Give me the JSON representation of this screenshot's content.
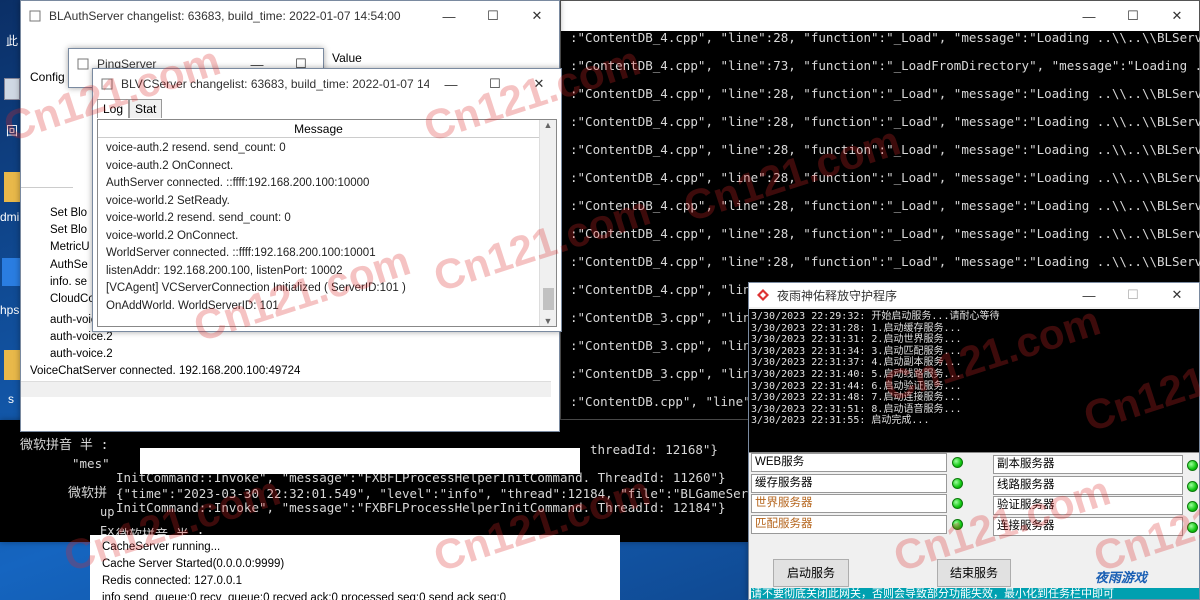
{
  "auth_window": {
    "title": "BLAuthServer changelist: 63683, build_time: 2022-01-07 14:54:00"
  },
  "auth_left_labels": [
    "Config",
    "Set Blo",
    "Set Blo",
    "MetricU",
    "AuthSe",
    "info. se",
    "CloudConn",
    "auth-voice.2",
    "auth-voice.2",
    "auth-voice.2"
  ],
  "auth_bottom_line": "VoiceChatServer connected. 192.168.200.100:49724",
  "ping_window": {
    "title": "PingServer",
    "value_header": "Value"
  },
  "vc_window": {
    "title": "BLVCServer changelist: 63683, build_time: 2022-01-07 14:...",
    "tab_log": "Log",
    "tab_stat": "Stat",
    "col_header": "Message",
    "lines": [
      "voice-auth.2 resend. send_count: 0",
      "voice-auth.2 OnConnect.",
      "AuthServer connected. ::ffff:192.168.200.100:10000",
      "voice-world.2 SetReady.",
      "voice-world.2 resend. send_count: 0",
      "voice-world.2 OnConnect.",
      "WorldServer connected. ::ffff:192.168.200.100:10001",
      "listenAddr: 192.168.200.100, listenPort: 10002",
      "[VCAgent] VCServerConnection Initialized ( ServerID:101 )",
      "OnAddWorld. WorldServerID: 101"
    ]
  },
  "console": {
    "lines": [
      ":\"ContentDB_4.cpp\", \"line\":28, \"function\":\"_Load\", \"message\":\"Loading ..\\\\..\\\\BLServer",
      ":\"ContentDB_4.cpp\", \"line\":73, \"function\":\"_LoadFromDirectory\", \"message\":\"Loading ..",
      ":\"ContentDB_4.cpp\", \"line\":28, \"function\":\"_Load\", \"message\":\"Loading ..\\\\..\\\\BLServer",
      ":\"ContentDB_4.cpp\", \"line\":28, \"function\":\"_Load\", \"message\":\"Loading ..\\\\..\\\\BLServer",
      ":\"ContentDB_4.cpp\", \"line\":28, \"function\":\"_Load\", \"message\":\"Loading ..\\\\..\\\\BLServer",
      ":\"ContentDB_4.cpp\", \"line\":28, \"function\":\"_Load\", \"message\":\"Loading ..\\\\..\\\\BLServer",
      ":\"ContentDB_4.cpp\", \"line\":28, \"function\":\"_Load\", \"message\":\"Loading ..\\\\..\\\\BLServer",
      ":\"ContentDB_4.cpp\", \"line\":28, \"function\":\"_Load\", \"message\":\"Loading ..\\\\..\\\\BLServer",
      ":\"ContentDB_4.cpp\", \"line\":28, \"function\":\"_Load\", \"message\":\"Loading ..\\\\..\\\\BLServer",
      ":\"ContentDB_4.cpp\", \"line\"",
      ":\"ContentDB_3.cpp\", \"line\"",
      ":\"ContentDB_3.cpp\", \"line\"",
      ":\"ContentDB_3.cpp\", \"line\"",
      ":\"ContentDB.cpp\", \"line\"",
      ":\"ContentDB_3.cpp\", \"line\""
    ]
  },
  "game_console": {
    "ime1": "微软拼音 半 :",
    "line_a": "\"mes\"",
    "line_a_right": "threadId: 12168\"}",
    "line_b": "InitCommand::Invoke\", \"message\":\"FXBFLProcessHelperInitCommand. ThreadId: 11260\"}",
    "ime2": "微软拼",
    "line_c": "{\"time\":\"2023-03-30 22:32:01.549\", \"level\":\"info\", \"thread\":12184, \"file\":\"BLGameServ",
    "line_d": "InitCommand::Invoke\", \"message\":\"FXBFLProcessHelperInitCommand. ThreadId: 12184\"}",
    "line_up": "up",
    "line_ex": "Ex",
    "ime3": "微软拼音 半 :"
  },
  "cache_window": {
    "lines": [
      "CacheServer running...",
      "Cache Server Started(0.0.0.0:9999)",
      "Redis connected: 127.0.0.1",
      "info send_queue:0 recv_queue:0 recved ack:0 processed seq:0 send ack seq:0"
    ]
  },
  "guard_window": {
    "title": "夜雨神佑释放守护程序",
    "log": [
      "3/30/2023 22:29:32: 开始启动服务...请耐心等待",
      "3/30/2023 22:31:28: 1.启动缓存服务...",
      "3/30/2023 22:31:31: 2.启动世界服务...",
      "3/30/2023 22:31:34: 3.启动匹配服务...",
      "3/30/2023 22:31:37: 4.启动副本服务...",
      "3/30/2023 22:31:40: 5.启动线路服务...",
      "3/30/2023 22:31:44: 6.启动验证服务...",
      "3/30/2023 22:31:48: 7.启动连接服务...",
      "3/30/2023 22:31:51: 8.启动语音服务...",
      "3/30/2023 22:31:55: 启动完成..."
    ],
    "services_left": [
      "WEB服务",
      "缓存服务器",
      "世界服务器",
      "匹配服务器"
    ],
    "services_right": [
      "副本服务器",
      "线路服务器",
      "验证服务器",
      "连接服务器"
    ],
    "start_button": "启动服务",
    "stop_button": "结束服务",
    "footer": "请不要彻底关闭此网关，否则会导致部分功能失效，最小化到任务栏中即可",
    "logo": "夜雨游戏"
  },
  "desktop": {
    "left_labels": [
      "此",
      "回",
      "dmi",
      "hps",
      "s"
    ]
  },
  "watermark": "Cn121.com",
  "colors": {
    "led_green": "#11c611",
    "console_bg": "#000000",
    "service_orange": "#b5651d"
  }
}
